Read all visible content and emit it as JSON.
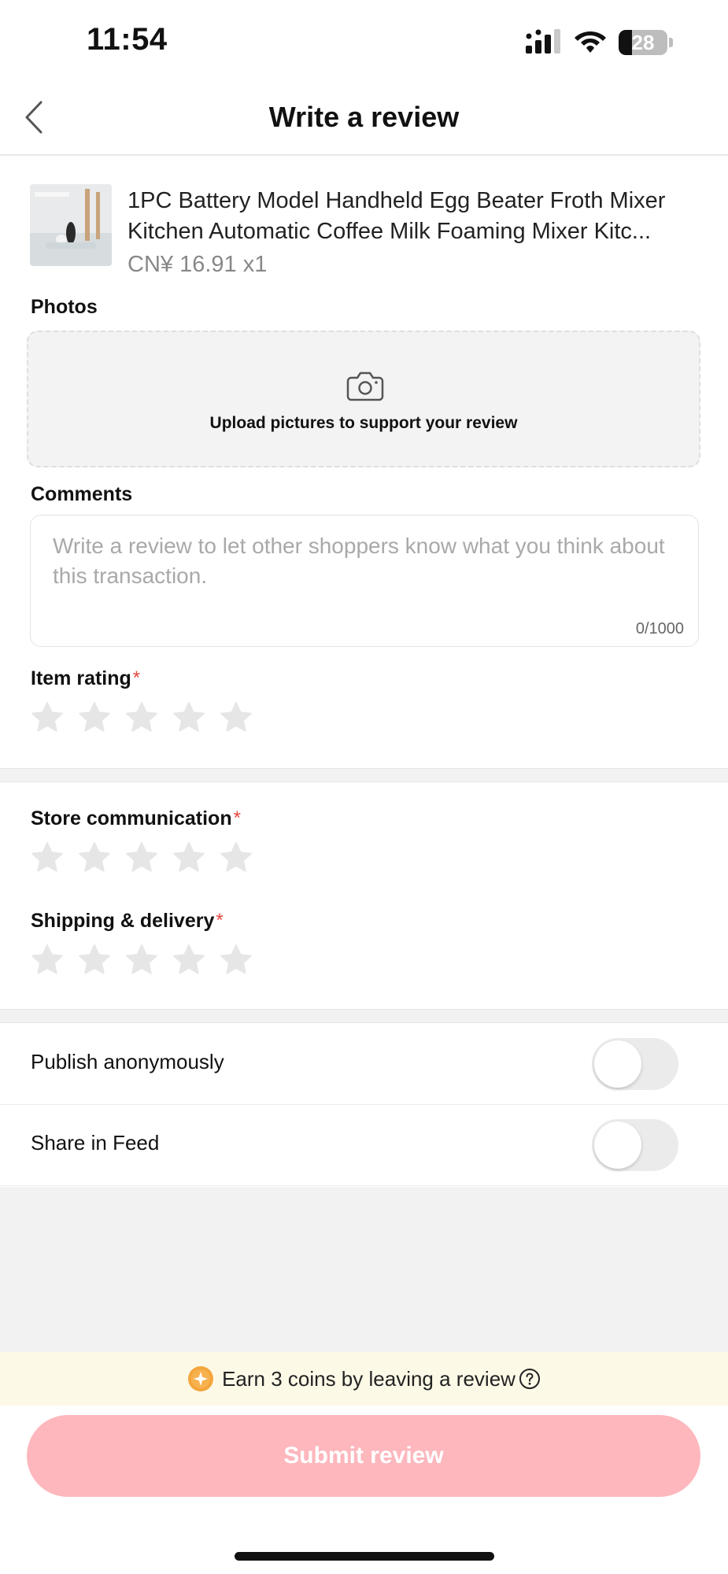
{
  "status_bar": {
    "time": "11:54",
    "battery_level": "28",
    "battery_fraction": 0.28,
    "icons": [
      "signal-icon",
      "wifi-icon",
      "battery-icon"
    ]
  },
  "nav": {
    "back_icon": "chevron-left-icon",
    "title": "Write a review"
  },
  "product": {
    "title": "1PC Battery Model Handheld Egg Beater Froth Mixer Kitchen Automatic Coffee Milk Foaming Mixer Kitc...",
    "price": "CN¥ 16.91 x1"
  },
  "photos": {
    "label": "Photos",
    "upload_icon": "camera-icon",
    "upload_text": "Upload pictures to support your review"
  },
  "comments": {
    "label": "Comments",
    "placeholder": "Write a review to let other shoppers know what you think about this transaction.",
    "value": "",
    "counter": "0/1000"
  },
  "ratings": {
    "item": {
      "label": "Item rating",
      "required_mark": "*",
      "value": 0,
      "max": 5
    },
    "store": {
      "label": "Store communication",
      "required_mark": "*",
      "value": 0,
      "max": 5
    },
    "shipping": {
      "label": "Shipping & delivery",
      "required_mark": "*",
      "value": 0,
      "max": 5
    }
  },
  "toggles": {
    "anonymous": {
      "label": "Publish anonymously",
      "on": false
    },
    "share": {
      "label": "Share in Feed",
      "on": false
    }
  },
  "coins_banner": {
    "icon": "coin-icon",
    "text": "Earn 3 coins by leaving a review",
    "help_icon": "question-circle-icon"
  },
  "submit": {
    "label": "Submit review",
    "enabled": false
  },
  "colors": {
    "required": "#e5483f",
    "submit_disabled": "#fdb7bd",
    "star_empty": "#e6e6e6",
    "coin": "#f4a53c",
    "banner_bg": "#fdf9e7"
  }
}
